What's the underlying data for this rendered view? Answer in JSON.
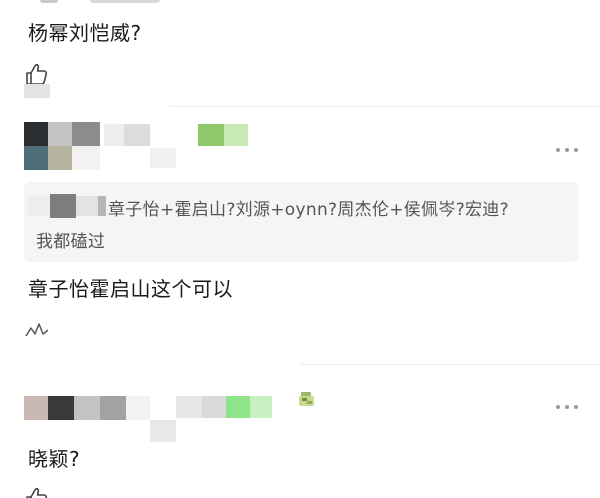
{
  "comments": [
    {
      "text": "杨幂刘恺威?"
    },
    {
      "quoted_text_line1": "章子怡+霍启山?刘源+oynn?周杰伦+侯佩岑?宏迪?",
      "quoted_text_line2": "我都磕过",
      "text": "章子怡霍启山这个可以"
    },
    {
      "text": "晓颖?"
    }
  ],
  "icons": {
    "like": "thumbs-up-icon",
    "more": "more-options-icon",
    "sticker": "sticker-icon"
  },
  "colors": {
    "quote_bg": "#f5f5f5",
    "divider": "#eeeeee",
    "mosaic_green": "#8dc96b"
  }
}
